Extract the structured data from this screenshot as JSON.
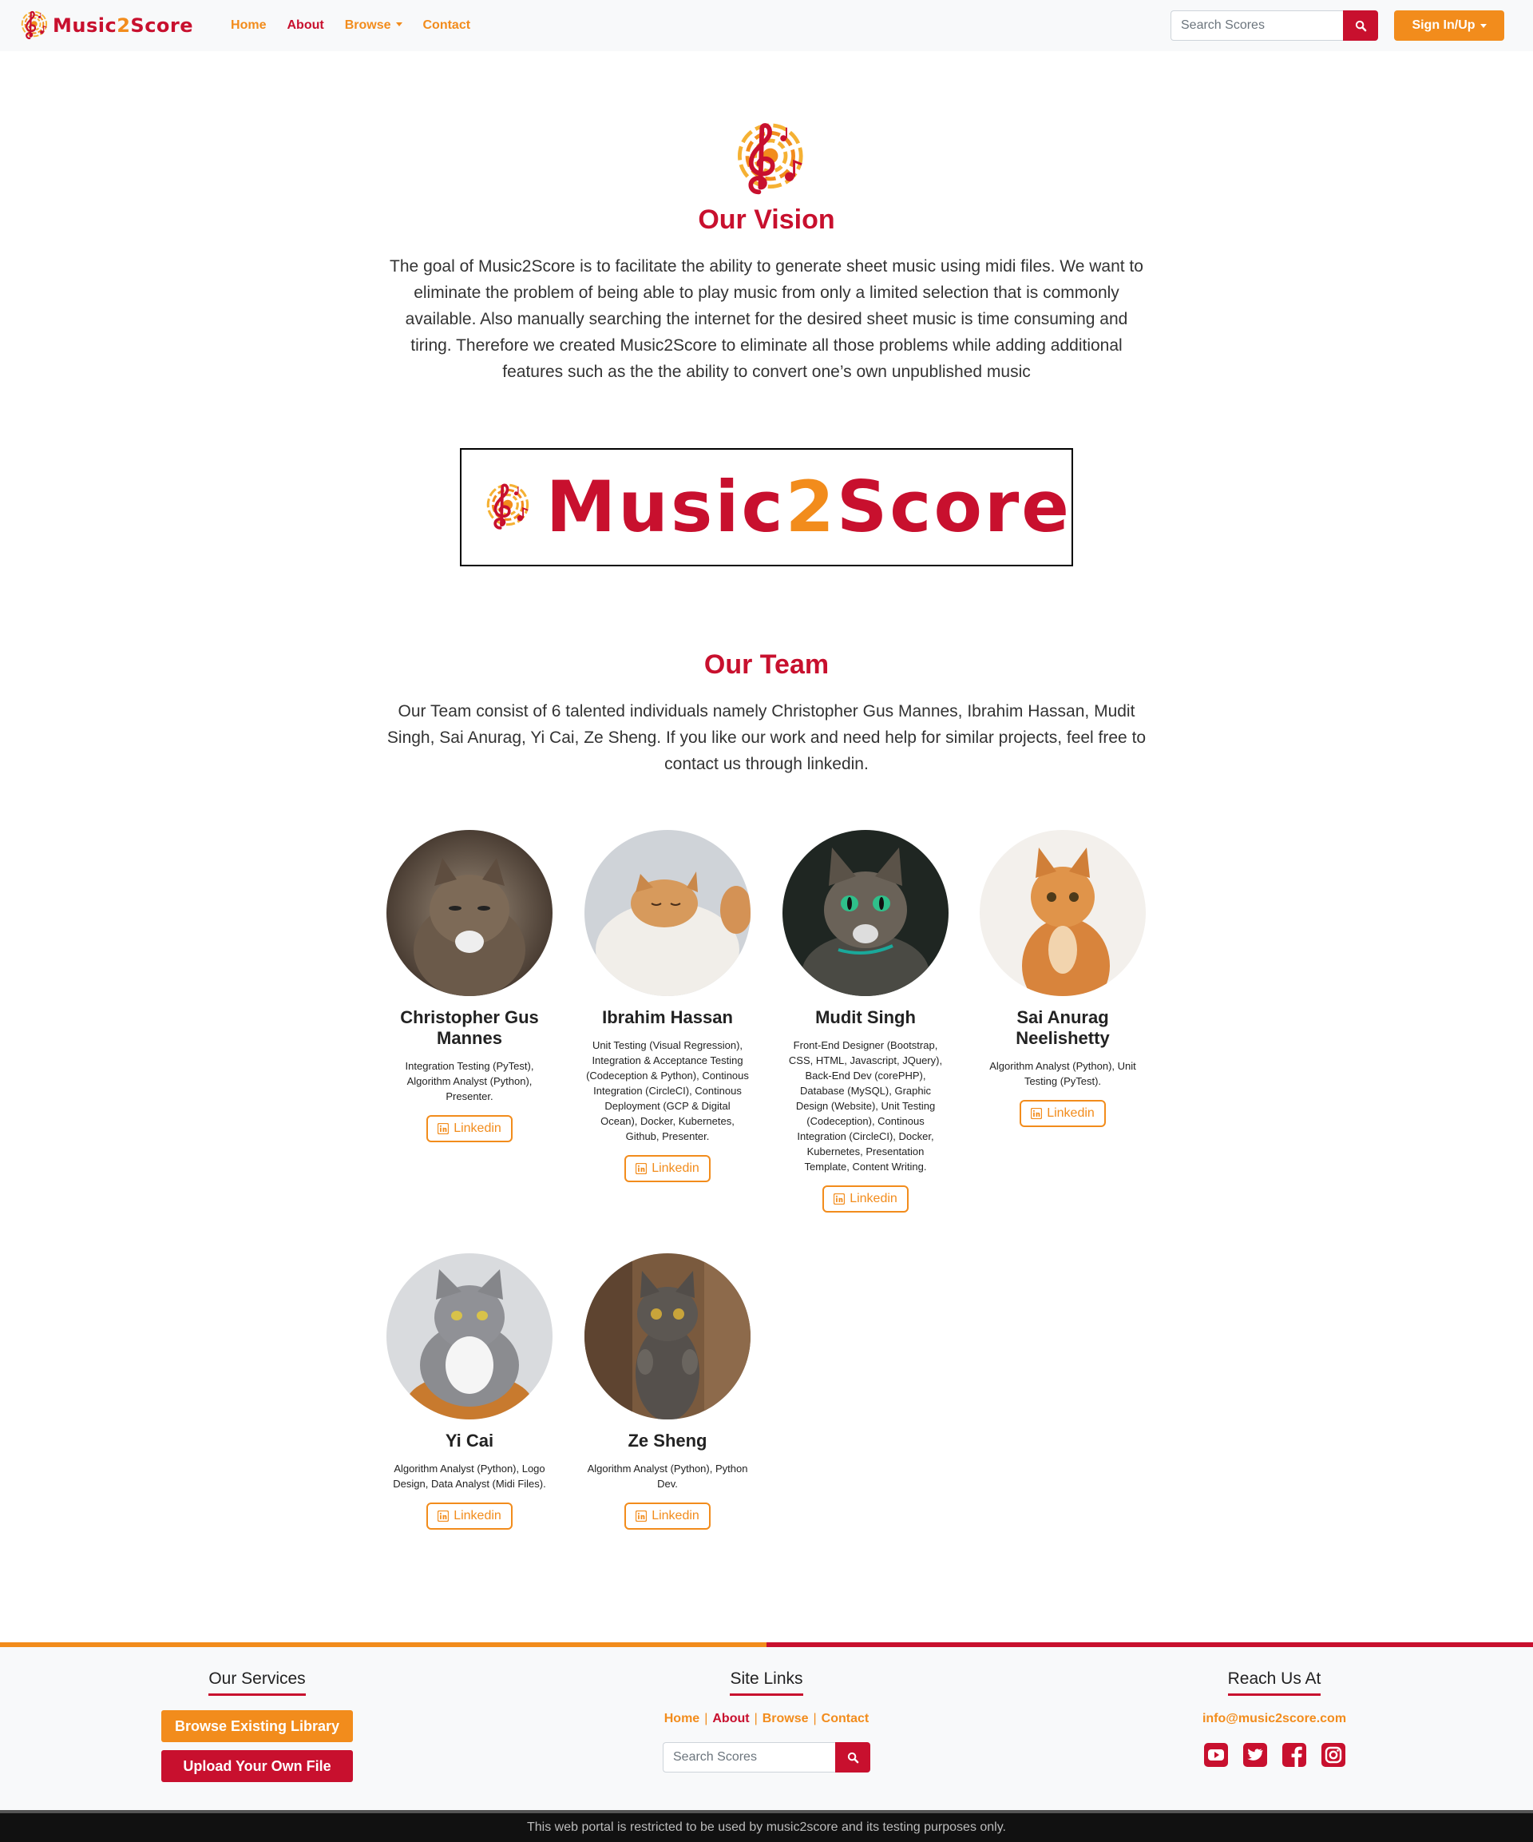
{
  "brand": {
    "name_part1": "Music",
    "name_two": "2",
    "name_part2": "Score"
  },
  "nav": {
    "home": "Home",
    "about": "About",
    "browse": "Browse",
    "contact": "Contact",
    "search_placeholder": "Search Scores",
    "signin": "Sign In/Up"
  },
  "vision": {
    "title": "Our Vision",
    "text": "The goal of Music2Score is to facilitate the ability to generate sheet music using midi files. We want to eliminate the problem of being able to play music from only a limited selection that is commonly available. Also manually searching the internet for the desired sheet music is time consuming and tiring. Therefore we created Music2Score to eliminate all those problems while adding additional features such as the the ability to convert one’s own unpublished music"
  },
  "banner": {
    "part1": "Music",
    "two": "2",
    "part2": "Score"
  },
  "team": {
    "title": "Our Team",
    "text": "Our Team consist of 6 talented individuals namely Christopher Gus Mannes, Ibrahim Hassan, Mudit Singh, Sai Anurag, Yi Cai, Ze Sheng. If you like our work and need help for similar projects, feel free to contact us through linkedin.",
    "linkedin_label": "Linkedin",
    "members": [
      {
        "name": "Christopher Gus Mannes",
        "role": "Integration Testing (PyTest), Algorithm Analyst (Python), Presenter."
      },
      {
        "name": "Ibrahim Hassan",
        "role": "Unit Testing (Visual Regression), Integration & Acceptance Testing (Codeception & Python), Continous Integration (CircleCI), Continous Deployment (GCP & Digital Ocean), Docker, Kubernetes, Github, Presenter."
      },
      {
        "name": "Mudit Singh",
        "role": "Front-End Designer (Bootstrap, CSS, HTML, Javascript, JQuery), Back-End Dev (corePHP), Database (MySQL), Graphic Design (Website), Unit Testing (Codeception), Continous Integration (CircleCI), Docker, Kubernetes, Presentation Template, Content Writing."
      },
      {
        "name": "Sai Anurag Neelishetty",
        "role": "Algorithm Analyst (Python), Unit Testing (PyTest)."
      },
      {
        "name": "Yi Cai",
        "role": "Algorithm Analyst (Python), Logo Design, Data Analyst (Midi Files)."
      },
      {
        "name": "Ze Sheng",
        "role": "Algorithm Analyst (Python), Python Dev."
      }
    ]
  },
  "footer": {
    "services_heading": "Our Services",
    "browse_btn": "Browse Existing Library",
    "upload_btn": "Upload Your Own File",
    "links_heading": "Site Links",
    "links": {
      "home": "Home",
      "about": "About",
      "browse": "Browse",
      "contact": "Contact",
      "sep": "|"
    },
    "search_placeholder": "Search Scores",
    "reach_heading": "Reach Us At",
    "email": "info@music2score.com",
    "social_icons": [
      "youtube-icon",
      "twitter-icon",
      "facebook-icon",
      "instagram-icon"
    ],
    "copyright": "This web portal is restricted to be used by music2score and its testing purposes only."
  },
  "colors": {
    "primary_red": "#c8102e",
    "accent_orange": "#f28c1c",
    "navbar_bg": "#f8f9fa",
    "footer_dark": "#111111"
  }
}
